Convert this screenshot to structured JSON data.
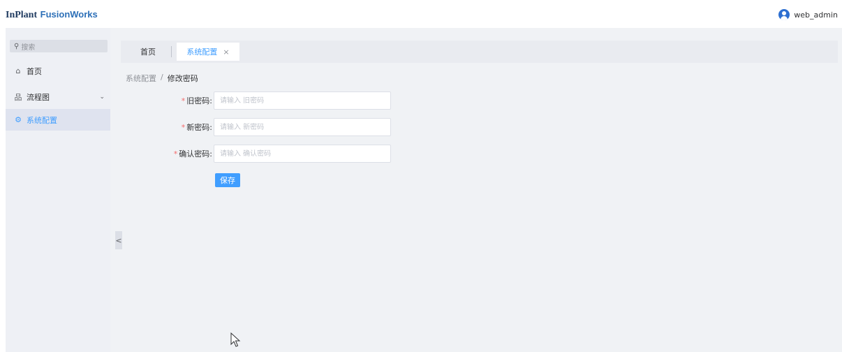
{
  "header": {
    "logo_brand": "InPlant",
    "logo_product": "FusionWorks",
    "username": "web_admin",
    "avatar_icon": "user-avatar-icon"
  },
  "sidebar": {
    "search_placeholder": "搜索",
    "items": [
      {
        "label": "首页",
        "icon": "home-icon",
        "glyph": "⌂"
      },
      {
        "label": "流程图",
        "icon": "flowchart-icon",
        "glyph": "品"
      },
      {
        "label": "系统配置",
        "icon": "gear-icon",
        "glyph": "⚙"
      }
    ],
    "active_color": "#409eff"
  },
  "tabs": {
    "home_label": "首页",
    "active_label": "系统配置",
    "close_glyph": "×"
  },
  "breadcrumb": {
    "parent": "系统配置",
    "separator": "/",
    "current": "修改密码"
  },
  "form": {
    "required_mark": "*",
    "old_password": {
      "label": "旧密码:",
      "placeholder": "请输入 旧密码",
      "value": ""
    },
    "new_password": {
      "label": "新密码:",
      "placeholder": "请输入 新密码",
      "value": ""
    },
    "confirm_password": {
      "label": "确认密码:",
      "placeholder": "请输入 确认密码",
      "value": ""
    },
    "save_label": "保存"
  },
  "collapse_glyph": "<"
}
